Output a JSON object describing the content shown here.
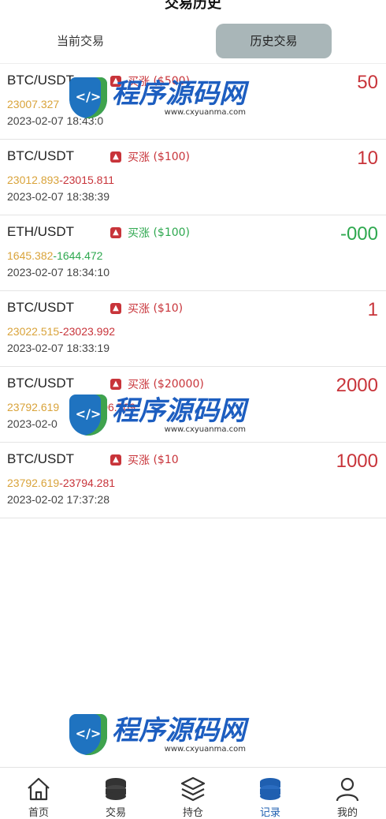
{
  "header": {
    "title": "交易历史"
  },
  "tabs": [
    {
      "label": "当前交易",
      "active": false
    },
    {
      "label": "历史交易",
      "active": true
    }
  ],
  "trades": [
    {
      "pair": "BTC/USDT",
      "direction": "买涨",
      "amount": "($500)",
      "open_price": "23007.327",
      "close_price": "",
      "time": "2023-02-07 18:43:0",
      "pl": "50",
      "color": "red"
    },
    {
      "pair": "BTC/USDT",
      "direction": "买涨",
      "amount": "($100)",
      "open_price": "23012.893",
      "close_price": "23015.811",
      "time": "2023-02-07 18:38:39",
      "pl": "10",
      "color": "red"
    },
    {
      "pair": "ETH/USDT",
      "direction": "买涨",
      "amount": "($100)",
      "open_price": "1645.382",
      "close_price": "1644.472",
      "time": "2023-02-07 18:34:10",
      "pl": "-000",
      "color": "green"
    },
    {
      "pair": "BTC/USDT",
      "direction": "买涨",
      "amount": "($10)",
      "open_price": "23022.515",
      "close_price": "23023.992",
      "time": "2023-02-07 18:33:19",
      "pl": "1",
      "color": "red"
    },
    {
      "pair": "BTC/USDT",
      "direction": "买涨",
      "amount": "($20000)",
      "open_price": "23792.619",
      "close_price": "96.709",
      "time": "2023-02-0",
      "pl": "2000",
      "color": "red"
    },
    {
      "pair": "BTC/USDT",
      "direction": "买涨",
      "amount": "($10",
      "open_price": "23792.619",
      "close_price": "23794.281",
      "time": "2023-02-02 17:37:28",
      "pl": "1000",
      "color": "red"
    }
  ],
  "watermark": {
    "text": "程序源码网",
    "url": "www.cxyuanma.com"
  },
  "nav": [
    {
      "label": "首页",
      "icon": "home-icon"
    },
    {
      "label": "交易",
      "icon": "coins-icon"
    },
    {
      "label": "持仓",
      "icon": "layers-icon"
    },
    {
      "label": "记录",
      "icon": "records-icon"
    },
    {
      "label": "我的",
      "icon": "user-icon"
    }
  ],
  "colors": {
    "up": "#c8343a",
    "down": "#2ea84f",
    "open_price": "#d9a33a",
    "active_tab": "#a9b6b8",
    "active_nav": "#1f5fb0"
  }
}
